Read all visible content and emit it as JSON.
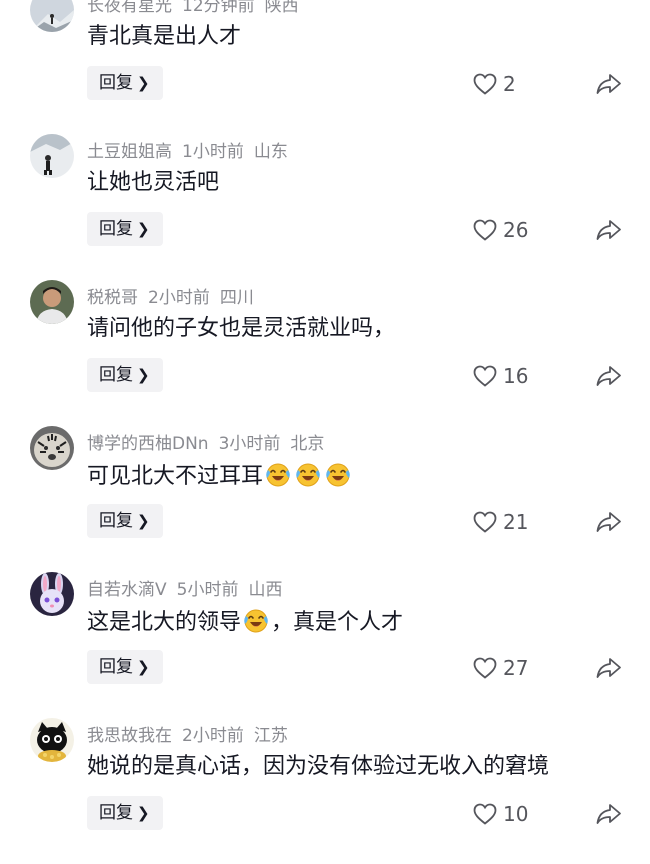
{
  "comments": [
    {
      "username": "长夜有星光",
      "time": "12分钟前",
      "location": "陕西",
      "text": "青北真是出人才",
      "emoji_count": 0,
      "text_after": "",
      "likes": "2",
      "reply_label": "回复",
      "avatar_icon": "mountain-climber-avatar"
    },
    {
      "username": "土豆姐姐高",
      "time": "1小时前",
      "location": "山东",
      "text": "让她也灵活吧",
      "emoji_count": 0,
      "text_after": "",
      "likes": "26",
      "reply_label": "回复",
      "avatar_icon": "snow-figure-avatar"
    },
    {
      "username": "税税哥",
      "time": "2小时前",
      "location": "四川",
      "text": "请问他的子女也是灵活就业吗，",
      "emoji_count": 0,
      "text_after": "",
      "likes": "16",
      "reply_label": "回复",
      "avatar_icon": "portrait-avatar"
    },
    {
      "username": "博学的西柚DNn",
      "time": "3小时前",
      "location": "北京",
      "text": "可见北大不过耳耳",
      "emoji_count": 3,
      "text_after": "",
      "likes": "21",
      "reply_label": "回复",
      "avatar_icon": "tiger-avatar"
    },
    {
      "username": "自若水滴V",
      "time": "5小时前",
      "location": "山西",
      "text": "这是北大的领导",
      "emoji_count": 1,
      "text_after": "，真是个人才",
      "likes": "27",
      "reply_label": "回复",
      "avatar_icon": "bunny-avatar"
    },
    {
      "username": "我思故我在",
      "time": "2小时前",
      "location": "江苏",
      "text": "她说的是真心话，因为没有体验过无收入的窘境",
      "emoji_count": 0,
      "text_after": "",
      "likes": "10",
      "reply_label": "回复",
      "avatar_icon": "cartoon-cat-avatar"
    }
  ],
  "icons": {
    "like": "heart-icon",
    "share": "share-arrow-icon",
    "reply_chevron": "chevron-right-icon",
    "emoji": "laughing-crying-emoji"
  },
  "colors": {
    "meta_text": "#8a8b91",
    "primary_text": "#161823",
    "reply_bg": "#f2f2f4"
  }
}
